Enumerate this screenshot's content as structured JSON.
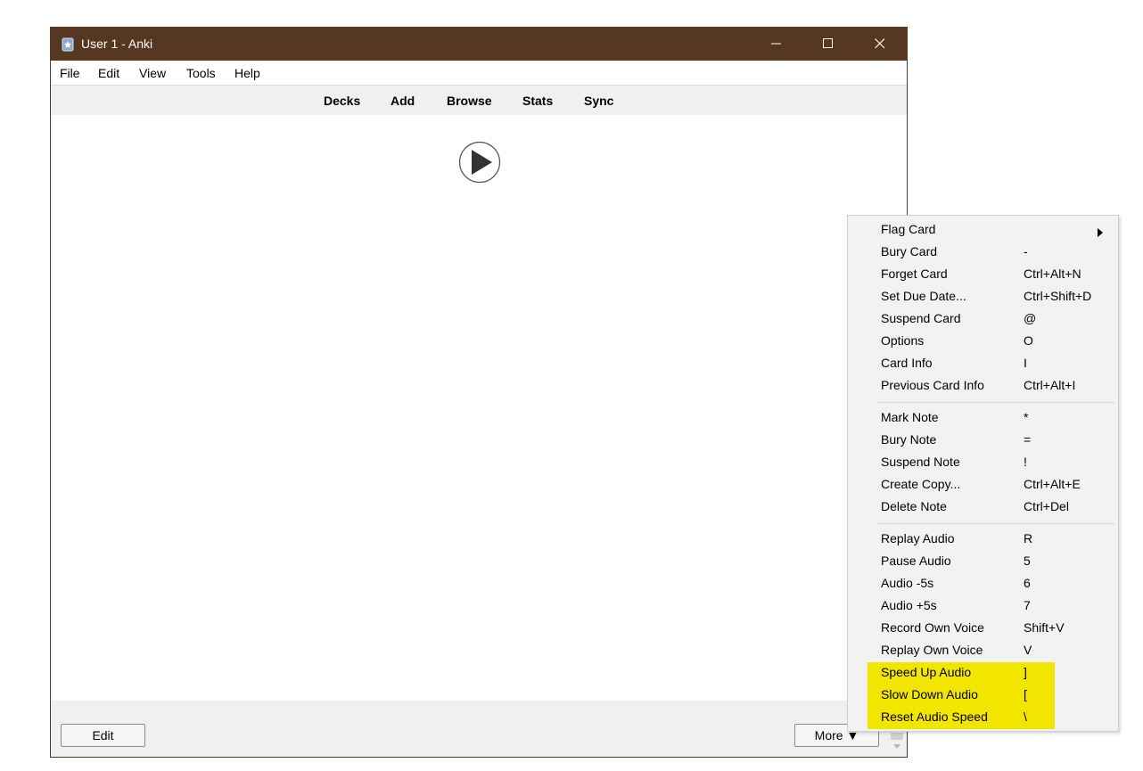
{
  "window": {
    "title": "User 1 - Anki"
  },
  "menubar": [
    "File",
    "Edit",
    "View",
    "Tools",
    "Help"
  ],
  "toolbar": [
    "Decks",
    "Add",
    "Browse",
    "Stats",
    "Sync"
  ],
  "bottom": {
    "edit_label": "Edit",
    "more_label": "More ▼"
  },
  "context_menu": {
    "groups": [
      [
        {
          "label": "Flag Card",
          "shortcut": "",
          "submenu": true
        },
        {
          "label": "Bury Card",
          "shortcut": "-"
        },
        {
          "label": "Forget Card",
          "shortcut": "Ctrl+Alt+N"
        },
        {
          "label": "Set Due Date...",
          "shortcut": "Ctrl+Shift+D"
        },
        {
          "label": "Suspend Card",
          "shortcut": "@"
        },
        {
          "label": "Options",
          "shortcut": "O"
        },
        {
          "label": "Card Info",
          "shortcut": "I"
        },
        {
          "label": "Previous Card Info",
          "shortcut": "Ctrl+Alt+I"
        }
      ],
      [
        {
          "label": "Mark Note",
          "shortcut": "*"
        },
        {
          "label": "Bury Note",
          "shortcut": "="
        },
        {
          "label": "Suspend Note",
          "shortcut": "!"
        },
        {
          "label": "Create Copy...",
          "shortcut": "Ctrl+Alt+E"
        },
        {
          "label": "Delete Note",
          "shortcut": "Ctrl+Del"
        }
      ],
      [
        {
          "label": "Replay Audio",
          "shortcut": "R"
        },
        {
          "label": "Pause Audio",
          "shortcut": "5"
        },
        {
          "label": "Audio -5s",
          "shortcut": "6"
        },
        {
          "label": "Audio +5s",
          "shortcut": "7"
        },
        {
          "label": "Record Own Voice",
          "shortcut": "Shift+V"
        },
        {
          "label": "Replay Own Voice",
          "shortcut": "V"
        },
        {
          "label": "Speed Up Audio",
          "shortcut": "]",
          "highlight": true
        },
        {
          "label": "Slow Down Audio",
          "shortcut": "[",
          "highlight": true
        },
        {
          "label": "Reset Audio Speed",
          "shortcut": "\\",
          "highlight": true
        }
      ]
    ]
  },
  "colors": {
    "titlebar": "#563822",
    "highlight": "#f2e500",
    "toolbar_bg": "#f0f0f0",
    "menu_bg": "#f2f2f2"
  },
  "icons": {
    "app": "anki-icon",
    "minimize": "minimize-icon",
    "maximize": "maximize-icon",
    "close": "close-icon",
    "play": "play-icon",
    "submenu": "triangle-right-icon"
  }
}
